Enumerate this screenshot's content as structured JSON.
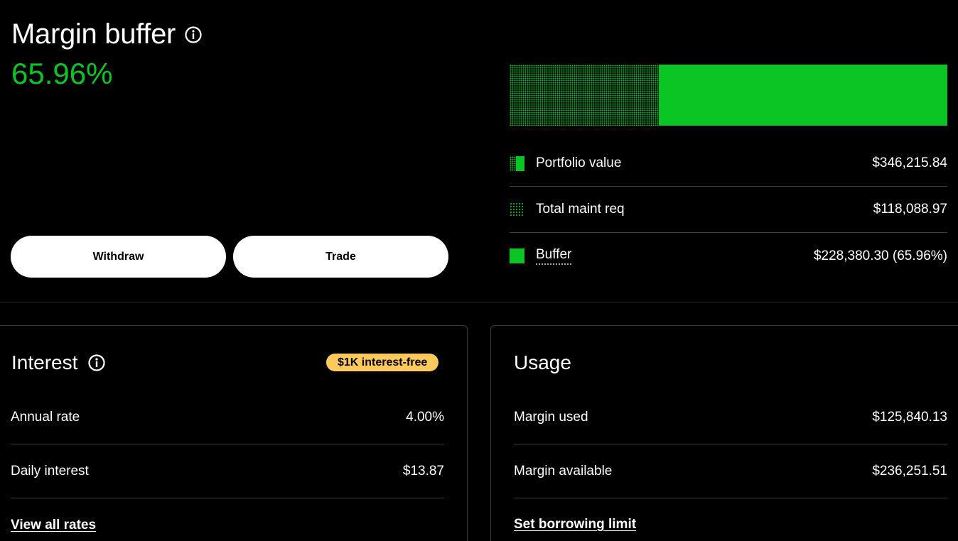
{
  "margin": {
    "title": "Margin buffer",
    "percent": "65.96%",
    "buffer_fraction": 0.6596,
    "withdraw_label": "Withdraw",
    "trade_label": "Trade"
  },
  "legend": [
    {
      "label": "Portfolio value",
      "value": "$346,215.84",
      "swatch": "split"
    },
    {
      "label": "Total maint req",
      "value": "$118,088.97",
      "swatch": "dots"
    },
    {
      "label": "Buffer",
      "value": "$228,380.30 (65.96%)",
      "swatch": "solid"
    }
  ],
  "interest": {
    "title": "Interest",
    "badge": "$1K interest-free",
    "rows": [
      {
        "label": "Annual rate",
        "value": "4.00%"
      },
      {
        "label": "Daily interest",
        "value": "$13.87"
      }
    ],
    "link": "View all rates"
  },
  "usage": {
    "title": "Usage",
    "rows": [
      {
        "label": "Margin used",
        "value": "$125,840.13"
      },
      {
        "label": "Margin available",
        "value": "$236,251.51"
      }
    ],
    "link": "Set borrowing limit"
  },
  "colors": {
    "accent": "#0bc524",
    "badge": "#ffc95c",
    "background": "#000000"
  },
  "icons": [
    "info-icon"
  ]
}
